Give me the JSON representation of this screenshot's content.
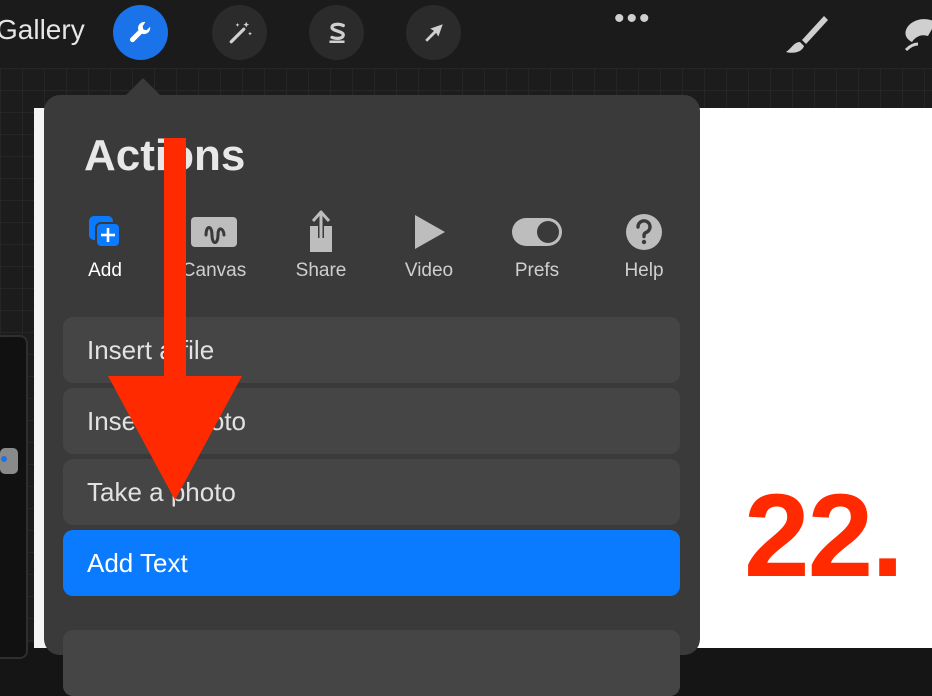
{
  "topbar": {
    "gallery_label": "Gallery",
    "tools": [
      {
        "name": "actions",
        "icon": "wrench-icon",
        "active": true
      },
      {
        "name": "adjustments",
        "icon": "magic-wand-icon",
        "active": false
      },
      {
        "name": "selection",
        "icon": "selection-s-icon",
        "active": false
      },
      {
        "name": "transform",
        "icon": "arrow-cursor-icon",
        "active": false
      }
    ],
    "more_label": "•••",
    "right_tools": [
      {
        "name": "brush",
        "icon": "brush-icon"
      },
      {
        "name": "smudge",
        "icon": "smudge-icon"
      }
    ]
  },
  "actions_panel": {
    "title": "Actions",
    "tabs": [
      {
        "label": "Add",
        "icon": "add-icon",
        "active": true
      },
      {
        "label": "Canvas",
        "icon": "canvas-icon",
        "active": false
      },
      {
        "label": "Share",
        "icon": "share-icon",
        "active": false
      },
      {
        "label": "Video",
        "icon": "play-icon",
        "active": false
      },
      {
        "label": "Prefs",
        "icon": "toggle-icon",
        "active": false
      },
      {
        "label": "Help",
        "icon": "question-icon",
        "active": false
      }
    ],
    "items": [
      {
        "label": "Insert a file",
        "active": false
      },
      {
        "label": "Insert a photo",
        "active": false
      },
      {
        "label": "Take a photo",
        "active": false
      },
      {
        "label": "Add Text",
        "active": true
      }
    ]
  },
  "annotation": {
    "step_number": "22.",
    "color": "#ff2a00"
  },
  "colors": {
    "accent": "#0a7aff",
    "panel": "#3a3a3a",
    "row": "#454545"
  }
}
